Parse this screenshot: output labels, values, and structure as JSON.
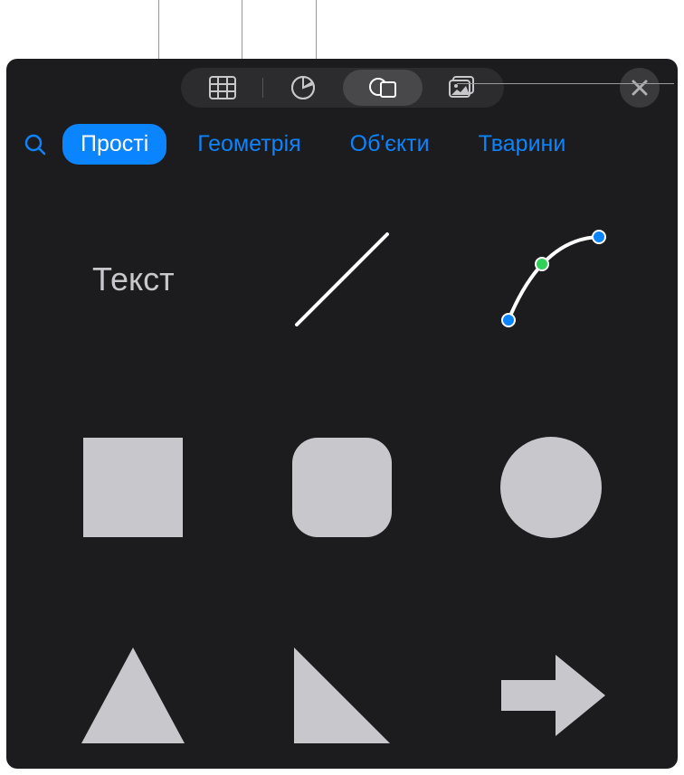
{
  "toolbar": {
    "buttons": [
      "table",
      "chart",
      "shapes",
      "media"
    ],
    "active": "shapes",
    "close_label": "Close"
  },
  "categories": {
    "items": [
      "Прості",
      "Геометрія",
      "Об'єкти",
      "Тварини"
    ],
    "active": "Прості"
  },
  "shapes": {
    "text_label": "Текст",
    "items": [
      "text",
      "line",
      "curve",
      "square",
      "rounded-square",
      "circle",
      "triangle",
      "right-triangle",
      "arrow-right"
    ]
  },
  "colors": {
    "accent": "#0a84ff",
    "shape_fill": "#c7c7cc",
    "bg": "#1c1c1e"
  }
}
